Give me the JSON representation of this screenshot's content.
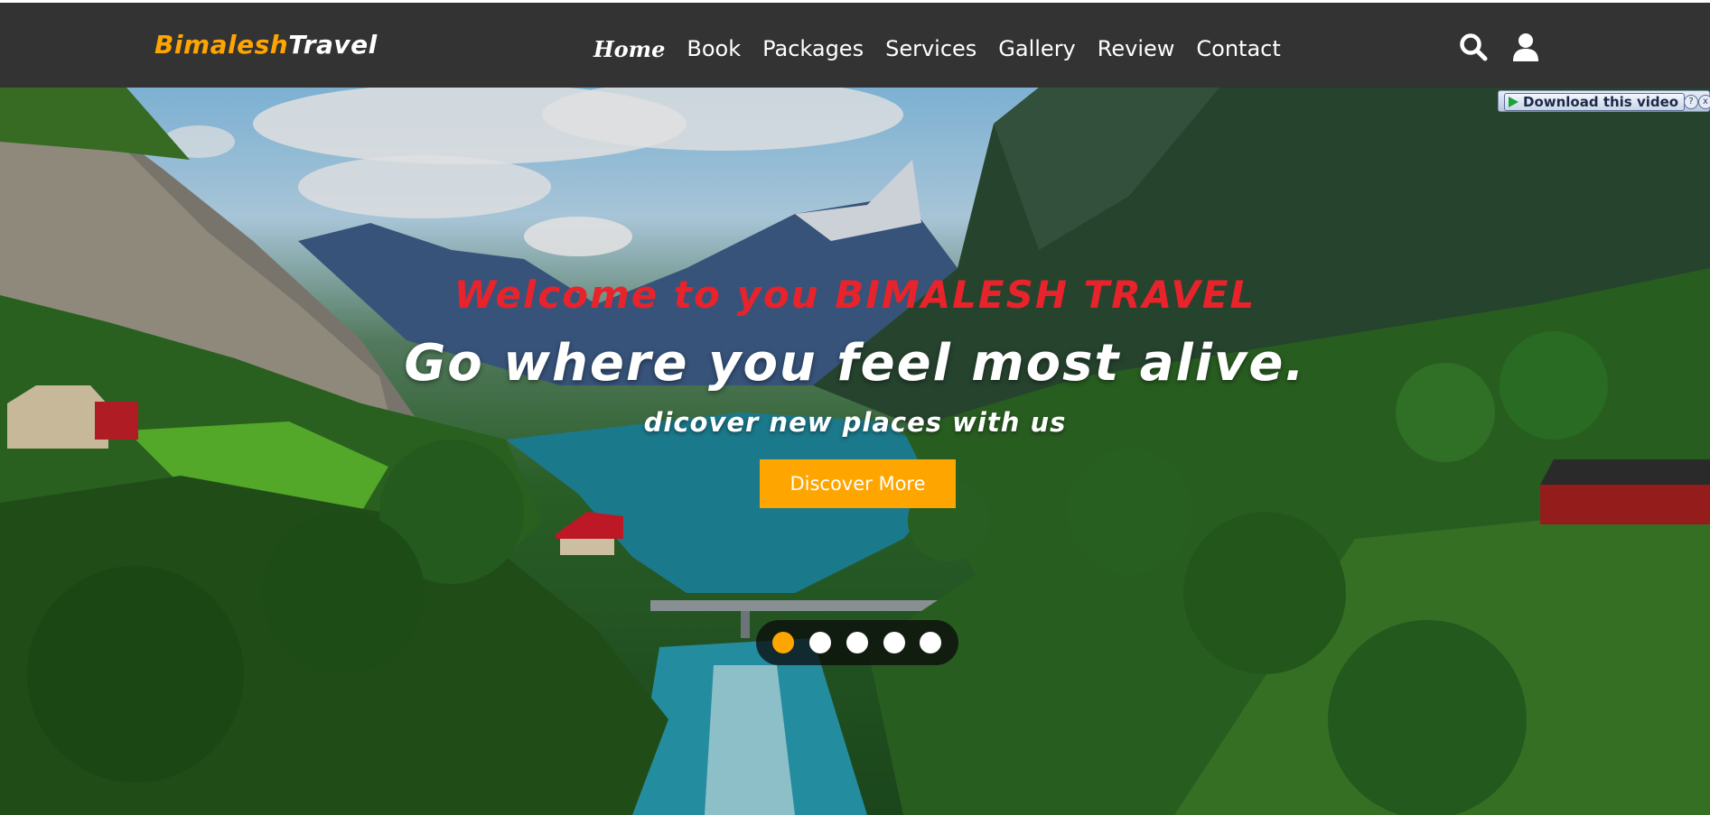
{
  "brand": {
    "part1": "Bimalesh",
    "part2": "Travel"
  },
  "nav": {
    "items": [
      {
        "label": "Home",
        "active": true
      },
      {
        "label": "Book"
      },
      {
        "label": "Packages"
      },
      {
        "label": "Services"
      },
      {
        "label": "Gallery"
      },
      {
        "label": "Review"
      },
      {
        "label": "Contact"
      }
    ]
  },
  "icons": {
    "search": "search-icon",
    "user": "user-icon"
  },
  "download_badge": {
    "label": "Download this video",
    "help": "?",
    "close": "x"
  },
  "hero": {
    "welcome": "Welcome to you BIMALESH TRAVEL",
    "tagline": "Go where you feel most alive.",
    "subtagline": "dicover new places with us",
    "cta": "Discover More"
  },
  "slider": {
    "count": 5,
    "active_index": 0
  },
  "colors": {
    "accent": "#ffa500",
    "header_bg": "#333333",
    "welcome": "#e8232b"
  }
}
